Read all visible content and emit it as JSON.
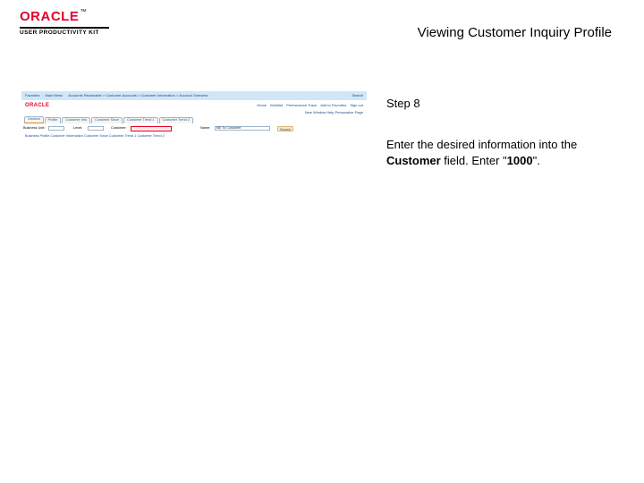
{
  "brand": {
    "name": "ORACLE",
    "tm": "™",
    "subtitle": "USER PRODUCTIVITY KIT"
  },
  "title": "Viewing Customer Inquiry Profile",
  "step": {
    "label": "Step 8"
  },
  "instruction": {
    "pre": "Enter the desired information into the ",
    "field": "Customer",
    "mid": " field. Enter \"",
    "value": "1000",
    "post": "\"."
  },
  "thumb": {
    "crumb_left": "Favorites",
    "crumb_mid": "Main Menu",
    "crumb_path": "Accounts Receivable > Customer Accounts > Customer Information > Account Overview",
    "crumb_right": "Search",
    "logo": "ORACLE",
    "nav_links": [
      "Home",
      "Worklist",
      "Performance Trace",
      "Add to Favorites",
      "Sign out"
    ],
    "sub_right": "New Window  Help  Personalize Page",
    "tabs": [
      "General",
      "Profile",
      "Customer Info",
      "Customer Since",
      "Customer Trend 1",
      "Customer Trend 2"
    ],
    "lbl_bu": "Business Unit:",
    "lbl_level": "Level:",
    "lbl_cust": "Customer:",
    "lbl_name": "Name:",
    "select_opt": "Bill To Customer",
    "btn_search": "Search",
    "footer": "Business Profile   Customer Information   Customer Since   Customer Trend 1   Customer Trend 2"
  }
}
